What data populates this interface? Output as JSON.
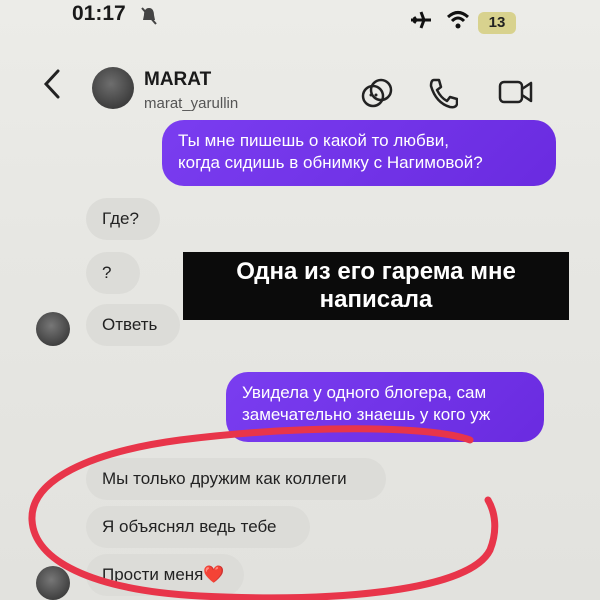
{
  "status_bar": {
    "time": "01:17",
    "battery": "13"
  },
  "header": {
    "name": "MARAT",
    "username": "marat_yarullin"
  },
  "messages": {
    "out_top": "Ты мне пишешь о какой то любви,\nкогда сидишь в обнимку с Нагимовой?",
    "in_where": "Где?",
    "in_question": "?",
    "in_answer": "Ответь",
    "out_blogger": "Увидела у одного блогера, сам\nзамечательно знаешь у кого уж",
    "in_friends": "Мы только дружим как коллеги",
    "in_explained": "Я объяснял ведь тебе",
    "in_sorry": "Прости меня❤️"
  },
  "caption": "Одна из его гарема мне\nнаписала",
  "colors": {
    "accent": "#6a2be0",
    "circle": "#e8354a"
  }
}
